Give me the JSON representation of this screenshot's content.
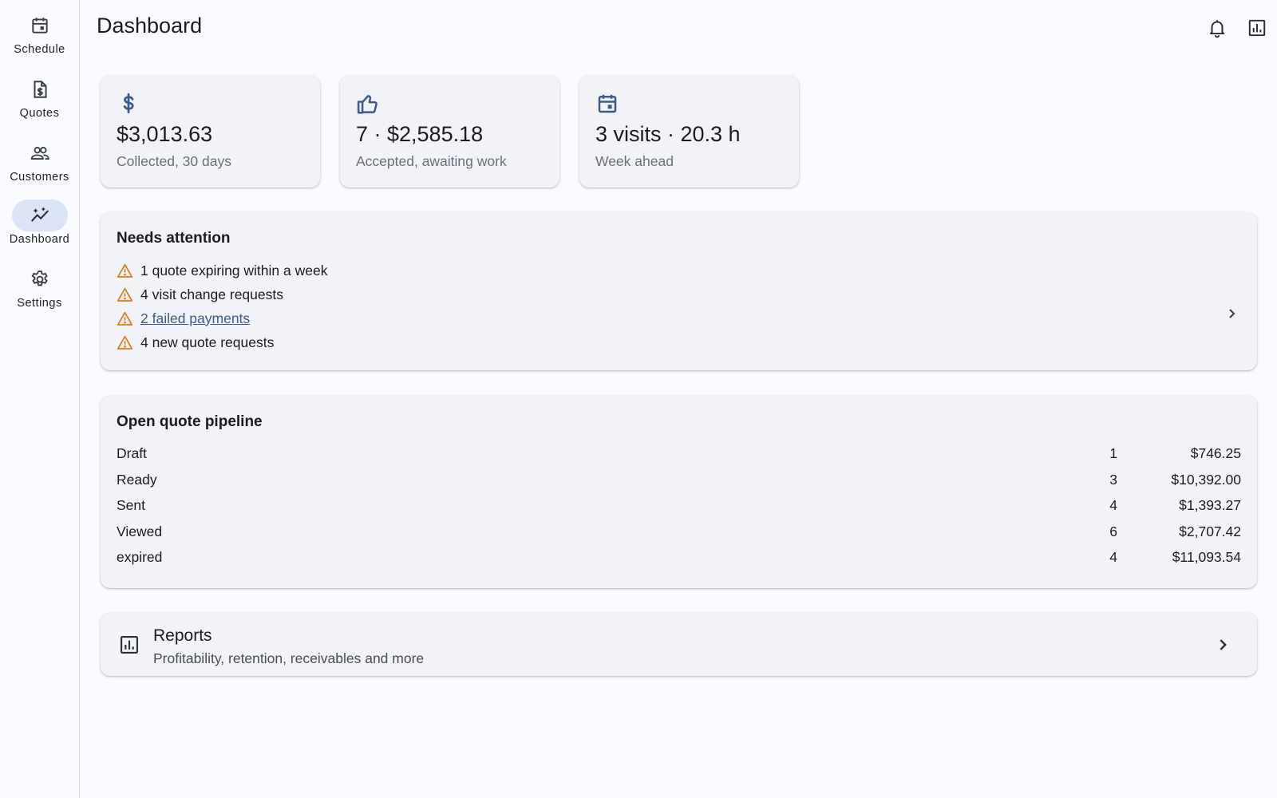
{
  "nav": {
    "items": [
      {
        "label": "Schedule",
        "icon": "calendar-icon",
        "active": false
      },
      {
        "label": "Quotes",
        "icon": "document-dollar-icon",
        "active": false
      },
      {
        "label": "Customers",
        "icon": "people-icon",
        "active": false
      },
      {
        "label": "Dashboard",
        "icon": "insights-icon",
        "active": true
      },
      {
        "label": "Settings",
        "icon": "gear-icon",
        "active": false
      }
    ]
  },
  "header": {
    "title": "Dashboard",
    "actions": [
      {
        "icon": "bell-icon"
      },
      {
        "icon": "bar-chart-icon"
      }
    ]
  },
  "stats": [
    {
      "icon": "dollar-icon",
      "value": "$3,013.63",
      "label": "Collected, 30 days"
    },
    {
      "icon": "thumb-up-icon",
      "value": "7 · $2,585.18",
      "label": "Accepted, awaiting work"
    },
    {
      "icon": "calendar-icon",
      "value": "3 visits · 20.3 h",
      "label": "Week ahead"
    }
  ],
  "attention": {
    "title": "Needs attention",
    "items": [
      {
        "text": "1 quote expiring within a week",
        "link": false
      },
      {
        "text": "4 visit change requests",
        "link": false
      },
      {
        "text": "2 failed payments",
        "link": true
      },
      {
        "text": "4 new quote requests",
        "link": false
      }
    ]
  },
  "pipeline": {
    "title": "Open quote pipeline",
    "rows": [
      {
        "status": "Draft",
        "count": "1",
        "amount": "$746.25"
      },
      {
        "status": "Ready",
        "count": "3",
        "amount": "$10,392.00"
      },
      {
        "status": "Sent",
        "count": "4",
        "amount": "$1,393.27"
      },
      {
        "status": "Viewed",
        "count": "6",
        "amount": "$2,707.42"
      },
      {
        "status": "expired",
        "count": "4",
        "amount": "$11,093.54"
      }
    ]
  },
  "reports": {
    "title": "Reports",
    "subtitle": "Profitability, retention, receivables and more"
  },
  "colors": {
    "primary": "#3d5a8a",
    "warning": "#e07b16",
    "active_indicator": "#dbe3f7",
    "card_bg": "#f2f3f8",
    "page_bg": "#fafbff"
  }
}
